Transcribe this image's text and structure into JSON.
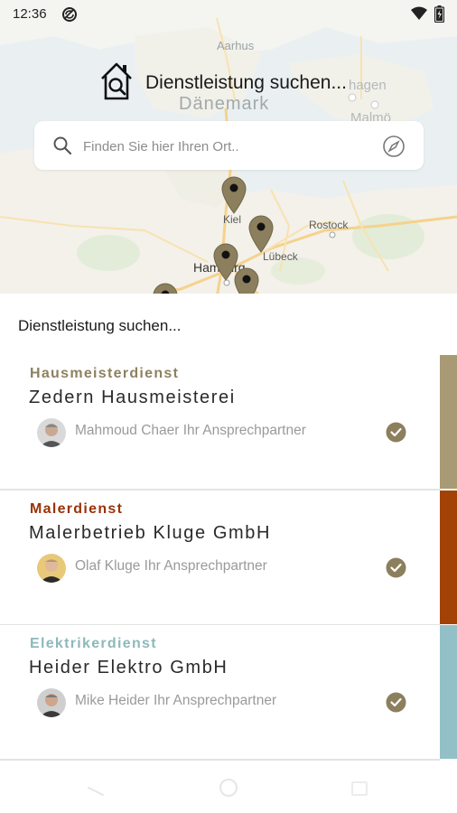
{
  "status_bar": {
    "time": "12:36"
  },
  "map": {
    "labels": {
      "aarhus": "Aarhus",
      "daenemark": "Dänemark",
      "kopenhagen": "hagen",
      "malmoe": "Malmö",
      "kiel": "Kiel",
      "rostock": "Rostock",
      "luebeck": "Lübeck",
      "hamburg": "Hamburg"
    },
    "header_title": "Dienstleistung suchen...",
    "search": {
      "placeholder": "Finden Sie hier Ihren Ort.."
    },
    "pin_color": "#8c7f5e"
  },
  "sheet": {
    "title": "Dienstleistung suchen...",
    "cards": [
      {
        "category": "Hausmeisterdienst",
        "category_color": "#8e8160",
        "company": "Zedern Hausmeisterei",
        "contact": "Mahmoud Chaer Ihr Ansprechpartner",
        "stripe_color": "#a79a75"
      },
      {
        "category": "Malerdienst",
        "category_color": "#9a3208",
        "company": "Malerbetrieb Kluge GmbH",
        "contact": "Olaf Kluge Ihr Ansprechpartner",
        "stripe_color": "#a34206"
      },
      {
        "category": "Elektrikerdienst",
        "category_color": "#8db8bc",
        "company": "Heider Elektro GmbH",
        "contact": "Mike Heider Ihr Ansprechpartner",
        "stripe_color": "#93c0c6"
      }
    ],
    "check_color": "#8c7f5e"
  }
}
